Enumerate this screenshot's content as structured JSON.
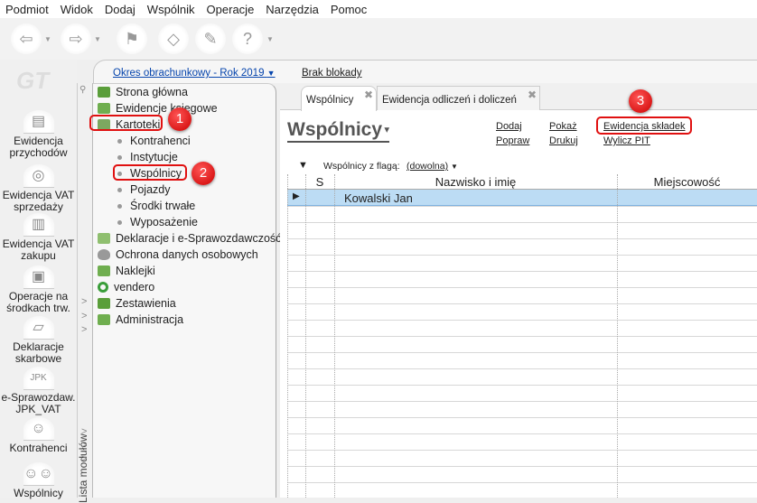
{
  "menu": [
    "Podmiot",
    "Widok",
    "Dodaj",
    "Wspólnik",
    "Operacje",
    "Narzędzia",
    "Pomoc"
  ],
  "toolbar_icons": [
    "back-arrow-icon",
    "forward-arrow-icon",
    "flag-icon",
    "eraser-icon",
    "brush-icon",
    "help-icon"
  ],
  "logo": "GT",
  "rail": [
    {
      "label": "Ewidencja przychodów",
      "icon": "printer-icon"
    },
    {
      "label": "Ewidencja VAT sprzedaży",
      "icon": "coins-icon"
    },
    {
      "label": "Ewidencja VAT zakupu",
      "icon": "register-icon"
    },
    {
      "label": "Operacje na środkach trw.",
      "icon": "computer-icon"
    },
    {
      "label": "Deklaracje skarbowe",
      "icon": "forms-icon"
    },
    {
      "label": "e-Sprawozdaw. JPK_VAT",
      "icon": "jpk-icon"
    },
    {
      "label": "Kontrahenci",
      "icon": "person-icon"
    },
    {
      "label": "Wspólnicy",
      "icon": "people-icon"
    }
  ],
  "topbar": {
    "period": "Okres obrachunkowy - Rok 2019",
    "lock": "Brak blokady"
  },
  "modules_label": "Lista modułów",
  "tree": [
    {
      "label": "Strona główna",
      "color": "#5a9e3a"
    },
    {
      "label": "Ewidencje księgowe",
      "color": "#6fae4f"
    },
    {
      "label": "Kartoteki",
      "color": "#7ca860"
    }
  ],
  "tree_sub": [
    "Kontrahenci",
    "Instytucje",
    "Wspólnicy",
    "Pojazdy",
    "Środki trwałe",
    "Wyposażenie"
  ],
  "tree2": [
    {
      "label": "Deklaracje i e-Sprawozdawczość",
      "color": "#8fbf6f"
    },
    {
      "label": "Ochrona danych osobowych",
      "color": "#999"
    },
    {
      "label": "Naklejki",
      "color": "#6fae4f"
    },
    {
      "label": "vendero",
      "color": "#3a9e3a"
    },
    {
      "label": "Zestawienia",
      "color": "#5a9e3a"
    },
    {
      "label": "Administracja",
      "color": "#6fae4f"
    }
  ],
  "tabs": [
    {
      "label": "Wspólnicy",
      "active": true
    },
    {
      "label": "Ewidencja odliczeń i doliczeń",
      "active": false
    }
  ],
  "title": "Wspólnicy",
  "actions": {
    "add": "Dodaj",
    "edit": "Popraw",
    "show": "Pokaż",
    "print": "Drukuj",
    "contrib": "Ewidencja składek",
    "pit": "Wylicz PIT"
  },
  "filter": {
    "label": "Wspólnicy z flagą:",
    "value": "(dowolna)"
  },
  "grid": {
    "columns": [
      "S",
      "Nazwisko i imię",
      "Miejscowość"
    ],
    "rows": [
      {
        "s": "",
        "name": "Kowalski Jan",
        "city": "",
        "selected": true
      }
    ]
  },
  "annotations": [
    "1",
    "2",
    "3"
  ],
  "annotation_color": "#e01010"
}
